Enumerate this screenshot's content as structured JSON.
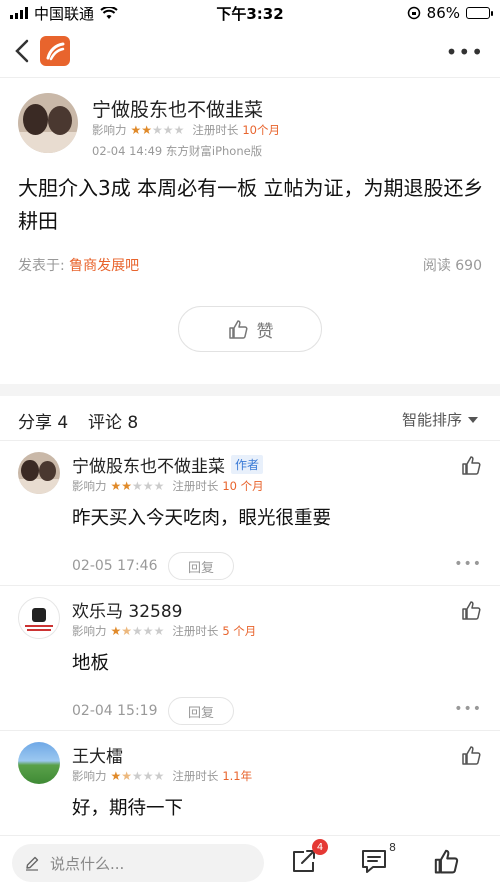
{
  "status_bar": {
    "carrier": "中国联通",
    "time": "下午3:32",
    "battery": "86%"
  },
  "post": {
    "author": "宁做股东也不做韭菜",
    "influence_label": "影响力",
    "influence_stars": 2,
    "reg_label": "注册时长",
    "reg_value": "10个月",
    "posted": "02-04 14:49 东方财富iPhone版",
    "body": "大胆介入3成 本周必有一板 立帖为证，为期退股还乡耕田",
    "forum_label": "发表于:",
    "forum_name": "鲁商发展吧",
    "read_count": "阅读 690",
    "like_label": "赞"
  },
  "tabs": {
    "share": "分享 4",
    "comment": "评论 8",
    "sort": "智能排序"
  },
  "comments": [
    {
      "name": "宁做股东也不做韭菜",
      "tag": "作者",
      "influence_label": "影响力",
      "stars": 2,
      "reg_label": "注册时长",
      "reg_value": "10 个月",
      "text": "昨天买入今天吃肉，眼光很重要",
      "time": "02-05 17:46",
      "reply": "回复"
    },
    {
      "name": "欢乐马 32589",
      "tag": "",
      "influence_label": "影响力",
      "stars": 1.5,
      "reg_label": "注册时长",
      "reg_value": "5 个月",
      "text": "地板",
      "time": "02-04 15:19",
      "reply": "回复"
    },
    {
      "name": "王大檑",
      "tag": "",
      "influence_label": "影响力",
      "stars": 1.5,
      "reg_label": "注册时长",
      "reg_value": "1.1年",
      "text": "好，期待一下"
    }
  ],
  "bottom_bar": {
    "input_placeholder": "说点什么...",
    "share_badge": "4",
    "comment_count": "8"
  },
  "colors": {
    "accent": "#e8642d",
    "star_on": "#e08a2a",
    "author_tag": "#3b7bd6",
    "badge": "#e53935"
  }
}
